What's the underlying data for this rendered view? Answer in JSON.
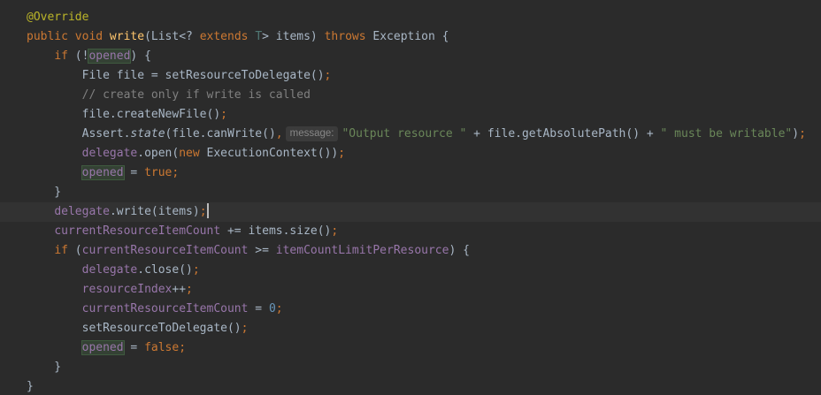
{
  "editor": {
    "language": "Java",
    "colors": {
      "background": "#2b2b2b",
      "current_line": "#323232",
      "keyword": "#cc7832",
      "annotation": "#bbb529",
      "method_decl": "#ffc66d",
      "field": "#9876aa",
      "string": "#6a8759",
      "comment": "#808080",
      "number": "#6897bb",
      "text": "#a9b7c6"
    },
    "current_line_index": 11,
    "lines": [
      [
        {
          "t": "ann",
          "v": "@Override"
        }
      ],
      [
        {
          "t": "kw",
          "v": "public void "
        },
        {
          "t": "fn",
          "v": "write"
        },
        {
          "t": "plain",
          "v": "(List<? "
        },
        {
          "t": "kw",
          "v": "extends "
        },
        {
          "t": "typeparam",
          "v": "T"
        },
        {
          "t": "plain",
          "v": "> items) "
        },
        {
          "t": "kw",
          "v": "throws "
        },
        {
          "t": "plain",
          "v": "Exception {"
        }
      ],
      [
        {
          "t": "plain",
          "v": "    "
        },
        {
          "t": "kw",
          "v": "if "
        },
        {
          "t": "plain",
          "v": "(!"
        },
        {
          "t": "field-hl",
          "v": "opened"
        },
        {
          "t": "plain",
          "v": ") {"
        }
      ],
      [
        {
          "t": "plain",
          "v": "        File file = setResourceToDelegate()"
        },
        {
          "t": "punct",
          "v": ";"
        }
      ],
      [
        {
          "t": "comment",
          "v": "        // create only if write is called"
        }
      ],
      [
        {
          "t": "plain",
          "v": "        file.createNewFile()"
        },
        {
          "t": "punct",
          "v": ";"
        }
      ],
      [
        {
          "t": "plain",
          "v": "        Assert."
        },
        {
          "t": "static",
          "v": "state"
        },
        {
          "t": "plain",
          "v": "(file.canWrite()"
        },
        {
          "t": "punct",
          "v": ","
        },
        {
          "t": "hint",
          "v": "message:"
        },
        {
          "t": "str",
          "v": "\"Output resource \""
        },
        {
          "t": "plain",
          "v": " + file.getAbsolutePath() + "
        },
        {
          "t": "str",
          "v": "\" must be writable\""
        },
        {
          "t": "plain",
          "v": ")"
        },
        {
          "t": "punct",
          "v": ";"
        }
      ],
      [
        {
          "t": "plain",
          "v": "        "
        },
        {
          "t": "field",
          "v": "delegate"
        },
        {
          "t": "plain",
          "v": ".open("
        },
        {
          "t": "kw",
          "v": "new "
        },
        {
          "t": "plain",
          "v": "ExecutionContext())"
        },
        {
          "t": "punct",
          "v": ";"
        }
      ],
      [
        {
          "t": "plain",
          "v": "        "
        },
        {
          "t": "field-hl",
          "v": "opened"
        },
        {
          "t": "plain",
          "v": " = "
        },
        {
          "t": "kw",
          "v": "true"
        },
        {
          "t": "punct",
          "v": ";"
        }
      ],
      [
        {
          "t": "plain",
          "v": "    }"
        }
      ],
      [
        {
          "t": "plain",
          "v": ""
        }
      ],
      [
        {
          "t": "plain",
          "v": "    "
        },
        {
          "t": "field",
          "v": "delegate"
        },
        {
          "t": "plain",
          "v": ".write(items)"
        },
        {
          "t": "punct",
          "v": ";"
        },
        {
          "t": "caret",
          "v": ""
        }
      ],
      [
        {
          "t": "plain",
          "v": "    "
        },
        {
          "t": "field",
          "v": "currentResourceItemCount"
        },
        {
          "t": "plain",
          "v": " += items.size()"
        },
        {
          "t": "punct",
          "v": ";"
        }
      ],
      [
        {
          "t": "plain",
          "v": "    "
        },
        {
          "t": "kw",
          "v": "if "
        },
        {
          "t": "plain",
          "v": "("
        },
        {
          "t": "field",
          "v": "currentResourceItemCount"
        },
        {
          "t": "plain",
          "v": " >= "
        },
        {
          "t": "field",
          "v": "itemCountLimitPerResource"
        },
        {
          "t": "plain",
          "v": ") {"
        }
      ],
      [
        {
          "t": "plain",
          "v": "        "
        },
        {
          "t": "field",
          "v": "delegate"
        },
        {
          "t": "plain",
          "v": ".close()"
        },
        {
          "t": "punct",
          "v": ";"
        }
      ],
      [
        {
          "t": "plain",
          "v": "        "
        },
        {
          "t": "field",
          "v": "resourceIndex"
        },
        {
          "t": "plain",
          "v": "++"
        },
        {
          "t": "punct",
          "v": ";"
        }
      ],
      [
        {
          "t": "plain",
          "v": "        "
        },
        {
          "t": "field",
          "v": "currentResourceItemCount"
        },
        {
          "t": "plain",
          "v": " = "
        },
        {
          "t": "num",
          "v": "0"
        },
        {
          "t": "punct",
          "v": ";"
        }
      ],
      [
        {
          "t": "plain",
          "v": "        setResourceToDelegate()"
        },
        {
          "t": "punct",
          "v": ";"
        }
      ],
      [
        {
          "t": "plain",
          "v": "        "
        },
        {
          "t": "field-hl",
          "v": "opened"
        },
        {
          "t": "plain",
          "v": " = "
        },
        {
          "t": "kw",
          "v": "false"
        },
        {
          "t": "punct",
          "v": ";"
        }
      ],
      [
        {
          "t": "plain",
          "v": "    }"
        }
      ],
      [
        {
          "t": "plain",
          "v": "}"
        }
      ]
    ]
  }
}
